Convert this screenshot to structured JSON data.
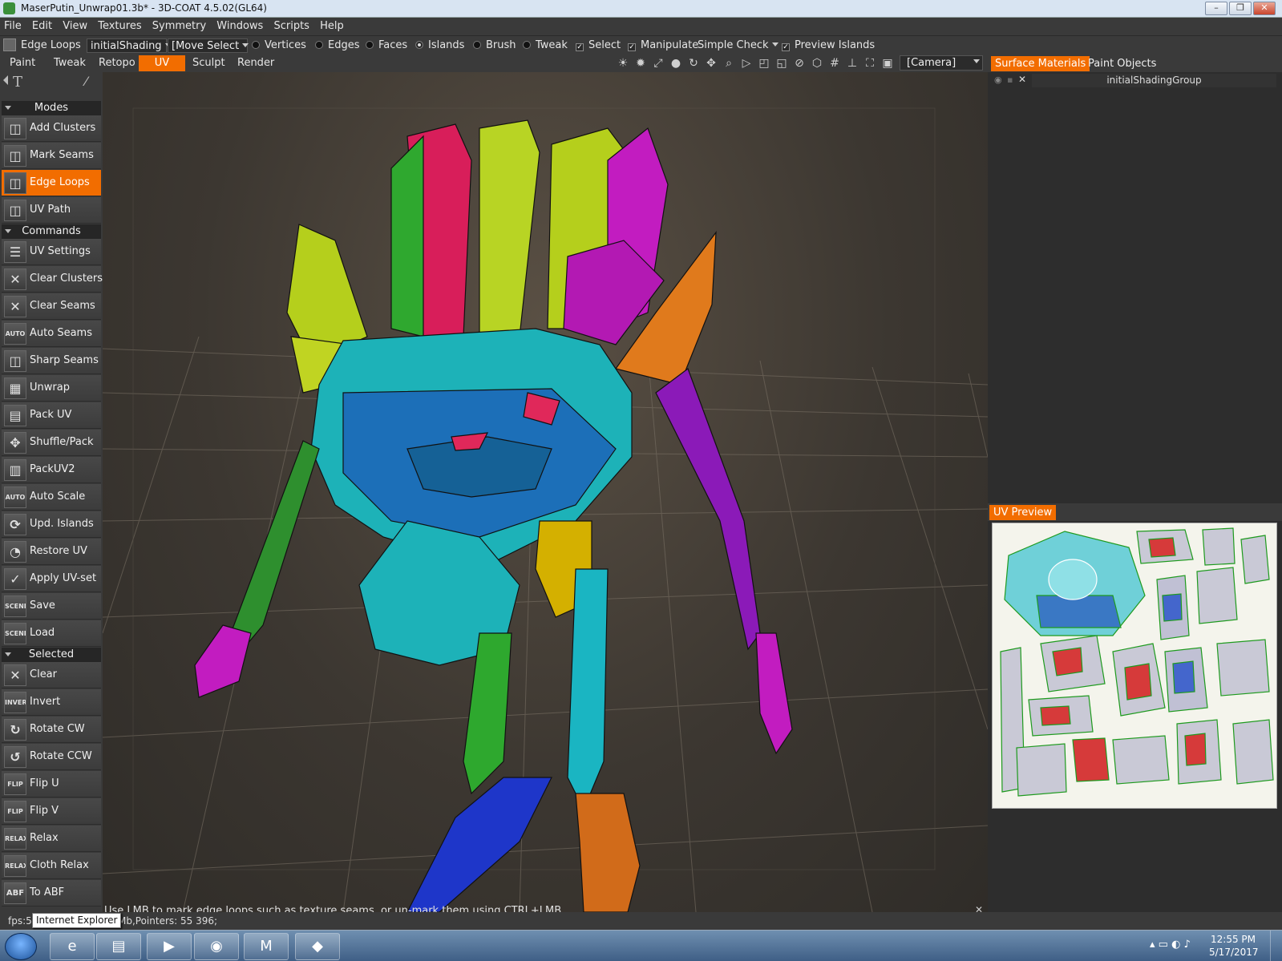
{
  "window": {
    "title": "MaserPutin_Unwrap01.3b* - 3D-COAT 4.5.02(GL64)",
    "btn_min": "–",
    "btn_max": "❐",
    "btn_close": "✕"
  },
  "menu": [
    "File",
    "Edit",
    "View",
    "Textures",
    "Symmetry",
    "Windows",
    "Scripts",
    "Help"
  ],
  "tool_options": {
    "current_tool": "Edge Loops",
    "shading_group": "initialShading",
    "move_mode": "[Move Select",
    "vertices": "Vertices",
    "edges": "Edges",
    "faces": "Faces",
    "islands": "Islands",
    "brush": "Brush",
    "tweak": "Tweak",
    "select": "Select",
    "manipulate": "Manipulate",
    "simple_check": "Simple Check",
    "preview_islands": "Preview Islands",
    "select_checked": true,
    "manipulate_checked": true,
    "preview_islands_checked": true
  },
  "rooms": {
    "paint": "Paint",
    "tweak": "Tweak",
    "retopo": "Retopo",
    "uv": "UV",
    "sculpt": "Sculpt",
    "render": "Render",
    "active": "UV"
  },
  "camera": "[Camera]",
  "left_panel": {
    "modes_header": "Modes",
    "modes": [
      "Add Clusters",
      "Mark Seams",
      "Edge Loops",
      "UV Path"
    ],
    "active_mode": "Edge Loops",
    "commands_header": "Commands",
    "commands": [
      "UV Settings",
      "Clear Clusters",
      "Clear Seams",
      "Auto Seams",
      "Sharp Seams",
      "Unwrap",
      "Pack UV",
      "Shuffle/Pack",
      "PackUV2",
      "Auto Scale",
      "Upd. Islands",
      "Restore UV",
      "Apply UV-set",
      "Save",
      "Load"
    ],
    "selected_header": "Selected",
    "selected": [
      "Clear",
      "Invert",
      "Rotate CW",
      "Rotate CCW",
      "Flip U",
      "Flip V",
      "Relax",
      "Cloth Relax",
      "To ABF"
    ],
    "icon_labels": {
      "auto": "AUTO",
      "scene": "SCENE",
      "invert": "INVERT",
      "flip_u": "FLIP U",
      "flip_v": "FLIP V",
      "relax": "RELAX",
      "abf": "ABF"
    }
  },
  "right_panel": {
    "tab_surface_materials": "Surface Materials",
    "tab_paint_objects": "Paint Objects",
    "material_name": "initialShadingGroup",
    "uv_preview": "UV Preview"
  },
  "hint": "Use LMB to mark edge loops such as texture seams, or un-mark them using CTRL+LMB",
  "status": {
    "fps": "fps:5",
    "mem": "Mb,Pointers: 55 396;"
  },
  "tooltip": "Internet Explorer",
  "clock": {
    "time": "12:55 PM",
    "date": "5/17/2017"
  },
  "colors": {
    "accent": "#f26d00",
    "panel": "#3a3a3a",
    "viewport_bg": "#3c3731"
  }
}
